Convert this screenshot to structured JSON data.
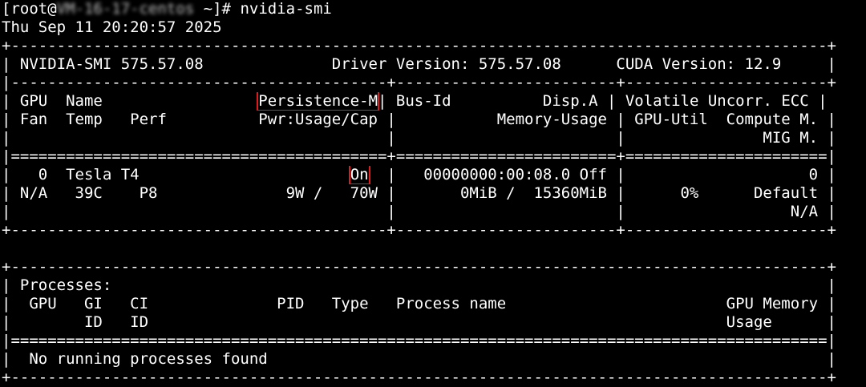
{
  "prompt": {
    "user": "[root@",
    "host_redacted": "VM-16-17-centos",
    "path": " ~]# ",
    "command": "nvidia-smi"
  },
  "timestamp": "Thu Sep 11 20:20:57 2025",
  "header": {
    "border_top": "+-----------------------------------------------------------------------------------------+",
    "line": "| NVIDIA-SMI 575.57.08              Driver Version: 575.57.08      CUDA Version: 12.9     |",
    "sep": "|-----------------------------------------+------------------------+----------------------+"
  },
  "gpu_table": {
    "head1_pre": "| GPU  Name                 ",
    "persistence_label": "Persistence-M",
    "head1_post": "| Bus-Id          Disp.A | Volatile Uncorr. ECC |",
    "head2": "| Fan  Temp   Perf          Pwr:Usage/Cap |           Memory-Usage | GPU-Util  Compute M. |",
    "head3": "|                                         |                        |               MIG M. |",
    "double_sep": "|=========================================+========================+======================|",
    "row1_pre": "|   0  Tesla T4                       ",
    "persistence_value": "On",
    "row1_post": "  |   00000000:00:08.0 Off |                    0 |",
    "row2": "| N/A   39C    P8              9W /   70W |       0MiB /  15360MiB |      0%      Default |",
    "row3": "|                                         |                        |                  N/A |",
    "border_bottom": "+-----------------------------------------+------------------------+----------------------+"
  },
  "processes": {
    "border_top": "+-----------------------------------------------------------------------------------------+",
    "title": "| Processes:                                                                              |",
    "head1": "|  GPU   GI   CI              PID   Type   Process name                        GPU Memory |",
    "head2": "|        ID   ID                                                               Usage      |",
    "double_sep": "|=========================================================================================|",
    "empty": "|  No running processes found                                                             |",
    "border_bottom": "+-----------------------------------------------------------------------------------------+"
  },
  "colors": {
    "background": "#000000",
    "text": "#ffffff",
    "highlight": "#e11b1b"
  }
}
